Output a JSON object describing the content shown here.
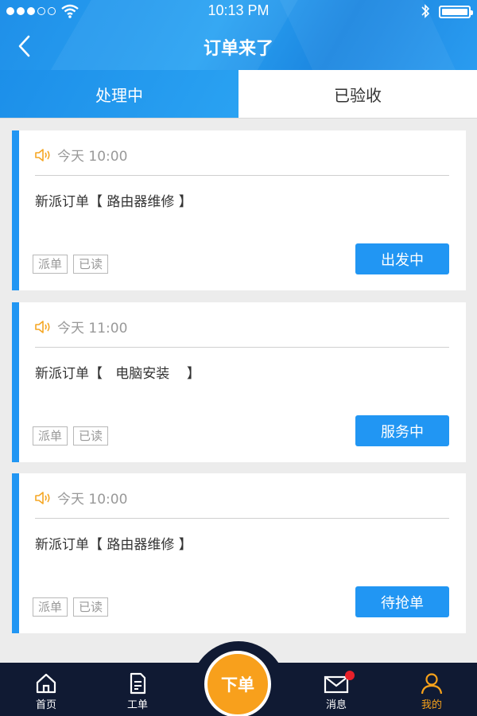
{
  "status_bar": {
    "time": "10:13 PM"
  },
  "header": {
    "title": "订单来了"
  },
  "tabs": [
    {
      "label": "处理中",
      "active": true
    },
    {
      "label": "已验收",
      "active": false
    }
  ],
  "orders": [
    {
      "time": "今天 10:00",
      "description": "新派订单【 路由器维修 】",
      "tags": [
        "派单",
        "已读"
      ],
      "action": "出发中"
    },
    {
      "time": "今天 11:00",
      "description": "新派订单【   电脑安装    】",
      "tags": [
        "派单",
        "已读"
      ],
      "action": "服务中"
    },
    {
      "time": "今天 10:00",
      "description": "新派订单【 路由器维修 】",
      "tags": [
        "派单",
        "已读"
      ],
      "action": "待抢单"
    }
  ],
  "bottom_nav": {
    "home": "首页",
    "workorder": "工单",
    "order": "下单",
    "messages": "消息",
    "mine": "我的"
  },
  "colors": {
    "primary": "#2196f3",
    "accent": "#f8a01c",
    "nav_bg": "#101a33"
  }
}
